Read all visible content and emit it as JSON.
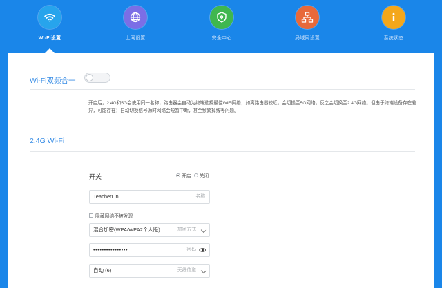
{
  "nav": {
    "items": [
      {
        "label": "Wi-Fi设置",
        "icon": "wifi-icon",
        "color": "#27a4ec",
        "active": true
      },
      {
        "label": "上网设置",
        "icon": "globe-icon",
        "color": "#7b6ee6",
        "active": false
      },
      {
        "label": "安全中心",
        "icon": "shield-icon",
        "color": "#3fb74f",
        "active": false
      },
      {
        "label": "局域网设置",
        "icon": "network-icon",
        "color": "#e8693a",
        "active": false
      },
      {
        "label": "系统状态",
        "icon": "info-icon",
        "color": "#f4a71b",
        "active": false
      }
    ]
  },
  "dual_band": {
    "title": "Wi-Fi双频合一",
    "enabled": false,
    "description": "开启后，2.4G和5G会使用同一名称，路由器会自动为终端选择最佳WiFi网络，如离路由器较近，会切换至5G网络，反之会切换至2.4G网络。但由于终端设备存在差异，可能存在：自动切换信号源时网络会短暂中断，甚至频繁掉线等问题。"
  },
  "wifi_24g": {
    "title": "2.4G Wi-Fi",
    "switch_label": "开关",
    "radio_on_label": "开启",
    "radio_off_label": "关闭",
    "switch_on": true,
    "ssid_value": "TeacherLin",
    "ssid_hint": "名称",
    "hide_label": "隐藏网络不被发现",
    "encryption_value": "混合加密(WPA/WPA2个人版)",
    "encryption_hint": "加密方式",
    "password_value": "••••••••••••••••",
    "password_hint": "密码",
    "channel_value": "自动 (6)",
    "channel_hint": "无线信道"
  },
  "colors": {
    "header_bg": "#1a86e9",
    "accent": "#3a8ee6"
  }
}
